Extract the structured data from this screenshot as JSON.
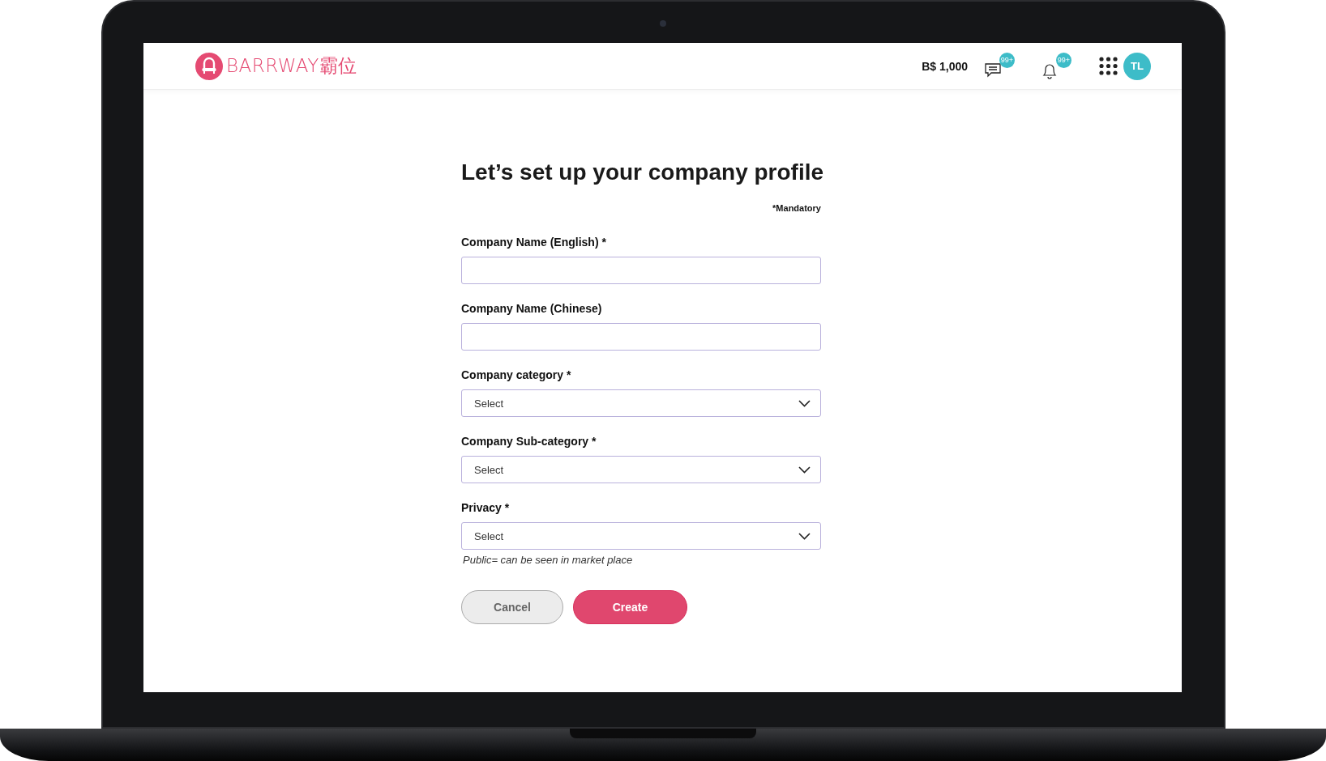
{
  "header": {
    "logo_text": "BARRWAY霸位",
    "balance": "B$ 1,000",
    "messages_badge": "99+",
    "notifications_badge": "99+",
    "avatar_initials": "TL"
  },
  "form": {
    "title": "Let’s set up your company profile",
    "mandatory_note": "*Mandatory",
    "fields": [
      {
        "kind": "text",
        "label": "Company Name (English) *"
      },
      {
        "kind": "text",
        "label": "Company Name (Chinese)"
      },
      {
        "kind": "select",
        "label": "Company category *",
        "value": "Select"
      },
      {
        "kind": "select",
        "label": "Company Sub-category *",
        "value": "Select"
      },
      {
        "kind": "select",
        "label": "Privacy *",
        "value": "Select",
        "hint": "Public= can be seen in market place"
      }
    ],
    "buttons": [
      {
        "kind": "secondary",
        "label": "Cancel"
      },
      {
        "kind": "primary",
        "label": "Create"
      }
    ]
  }
}
